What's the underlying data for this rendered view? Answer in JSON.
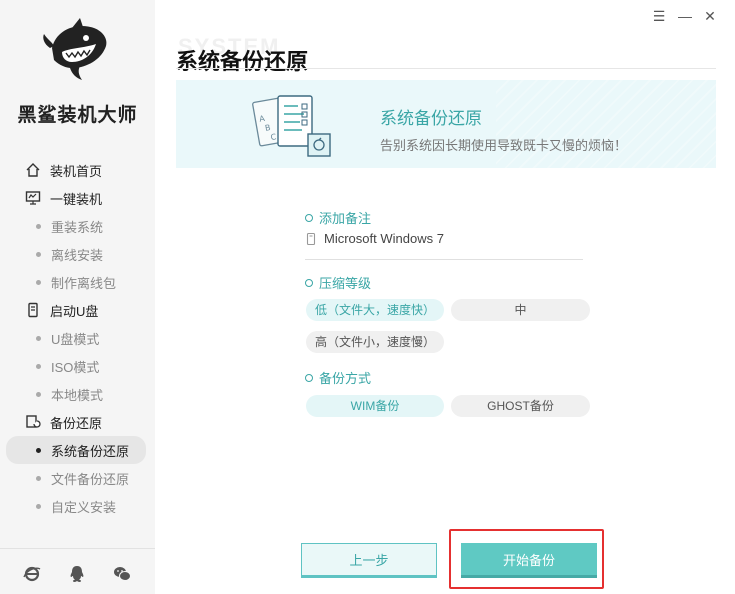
{
  "app": {
    "name": "黑鲨装机大师"
  },
  "window_controls": {
    "menu": "☰",
    "minimize": "—",
    "close": "✕"
  },
  "sidebar": {
    "sections": [
      {
        "label": "装机首页",
        "icon": "home-icon",
        "items": []
      },
      {
        "label": "一键装机",
        "icon": "monitor-icon",
        "items": [
          "重装系统",
          "离线安装",
          "制作离线包"
        ]
      },
      {
        "label": "启动U盘",
        "icon": "usb-icon",
        "items": [
          "U盘模式",
          "ISO模式",
          "本地模式"
        ]
      },
      {
        "label": "备份还原",
        "icon": "backup-icon",
        "items": [
          "系统备份还原",
          "文件备份还原",
          "自定义安装"
        ]
      }
    ],
    "active_item": "系统备份还原",
    "footer_icons": [
      "ie-browser-icon",
      "qq-icon",
      "wechat-icon"
    ]
  },
  "header": {
    "watermark": "SYSTEM",
    "title": "系统备份还原"
  },
  "banner": {
    "title": "系统备份还原",
    "subtitle": "告别系统因长期使用导致既卡又慢的烦恼！"
  },
  "form": {
    "note_label": "添加备注",
    "note_value": "Microsoft Windows 7",
    "compression_label": "压缩等级",
    "compression_options": [
      "低（文件大，速度快）",
      "中",
      "高（文件小，速度慢）"
    ],
    "compression_selected": "低（文件大，速度快）",
    "method_label": "备份方式",
    "method_options": [
      "WIM备份",
      "GHOST备份"
    ],
    "method_selected": "WIM备份"
  },
  "buttons": {
    "prev": "上一步",
    "start": "开始备份"
  },
  "colors": {
    "accent": "#3aa6a6",
    "button": "#5fc9c3",
    "highlight": "#e53030"
  }
}
